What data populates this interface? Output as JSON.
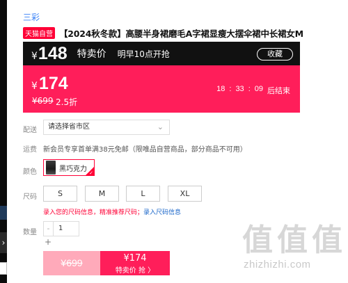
{
  "brand": "三彩",
  "product": {
    "badge": "天猫自营",
    "title": "【2024秋冬款】高腰半身裙磨毛A字裙显瘦大摆伞裙中长裙女M"
  },
  "promo": {
    "currency": "¥",
    "price": "148",
    "type": "特卖价",
    "start_text": "明早10点开抢",
    "collect_label": "收藏"
  },
  "price": {
    "currency": "¥",
    "current": "174",
    "original": "¥699",
    "discount": "2.5折",
    "countdown": [
      "18",
      ":",
      "33",
      ":",
      "09",
      "后结束"
    ]
  },
  "shipping": {
    "label": "配送",
    "placeholder": "请选择省市区"
  },
  "freight": {
    "label": "运费",
    "text": "新会员专享首单满38元免邮（限唯品自营商品，部分商品不可用）"
  },
  "color": {
    "label": "颜色",
    "option": "黑巧克力"
  },
  "size": {
    "label": "尺码",
    "options": [
      "S",
      "M",
      "L",
      "XL"
    ],
    "hint_prefix": "录入您的尺码信息，精准推荐尺码；",
    "hint_link": "录入尺码信息"
  },
  "quantity": {
    "label": "数量",
    "value": "1",
    "minus": "-",
    "plus": "+"
  },
  "buttons": {
    "original_price": "¥699",
    "special_price": "¥174",
    "special_label": "特卖价 抢 〉"
  },
  "watermark": {
    "glyphs": "值值值",
    "text": "zhizhizhi.com"
  },
  "icons": {
    "left_nav": "chevron-right-icon",
    "dropdown": "chevron-down-icon",
    "check": "check-icon"
  },
  "colors": {
    "accent": "#ff1e5a",
    "promo_bar": "#111111",
    "brand_link": "#3a82f7"
  }
}
